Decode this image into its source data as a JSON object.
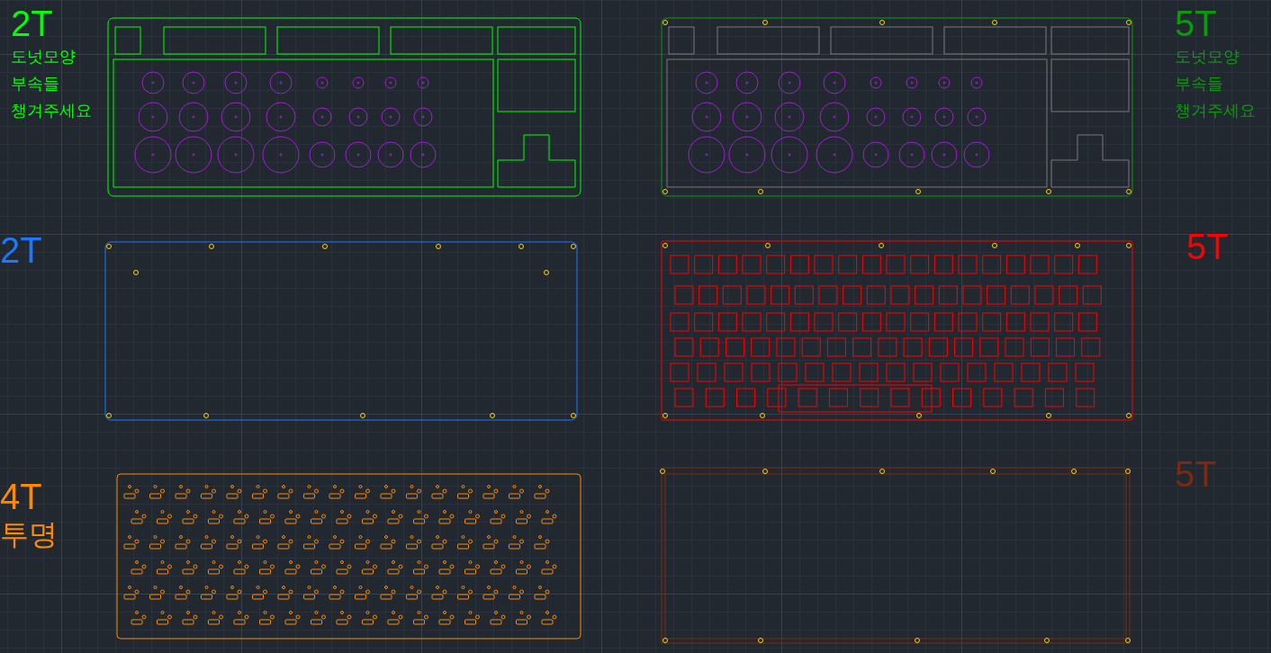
{
  "panels": [
    {
      "kind": "donut-top",
      "color": "#00ff00",
      "label": "2T",
      "notes": [
        "도넛모양",
        "부속들",
        "챙겨주세요"
      ]
    },
    {
      "kind": "donut-frame",
      "color": "#0a9a0a",
      "label": "5T",
      "notes": [
        "도넛모양",
        "부속들",
        "챙겨주세요"
      ]
    },
    {
      "kind": "blank",
      "color": "#1e78ff",
      "label": "2T"
    },
    {
      "kind": "keyplate",
      "color": "#ff0000",
      "label": "5T"
    },
    {
      "kind": "switchplate",
      "color": "#ff8a00",
      "label": "4T",
      "notes": [
        "투명"
      ]
    },
    {
      "kind": "bottom",
      "color": "#7a2a10",
      "label": "5T"
    }
  ]
}
